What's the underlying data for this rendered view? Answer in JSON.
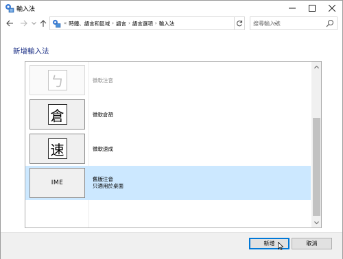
{
  "window": {
    "title": "輸入法",
    "icon": "ime-settings-icon"
  },
  "nav": {
    "breadcrumb_lead": "«",
    "breadcrumbs": [
      "時鐘、語言和區域",
      "語言",
      "語言選項",
      "輸入法"
    ],
    "search_placeholder": "搜尋輸入法"
  },
  "page": {
    "title": "新增輸入法"
  },
  "ime_list": {
    "items": [
      {
        "glyph": "ㄅ",
        "label": "微軟注音",
        "faded": true,
        "selected": false
      },
      {
        "glyph": "倉",
        "label": "微軟倉頡",
        "faded": false,
        "selected": false
      },
      {
        "glyph": "速",
        "label": "微軟速成",
        "faded": false,
        "selected": false
      },
      {
        "glyph": "IME",
        "label_line1": "舊版注音",
        "label_line2": "只適用於桌面",
        "faded": false,
        "selected": true
      }
    ]
  },
  "footer": {
    "add_label": "新增",
    "cancel_label": "取消"
  },
  "colors": {
    "selection": "#cce8ff",
    "page_title": "#1e3287",
    "default_button_border": "#0078d7"
  }
}
